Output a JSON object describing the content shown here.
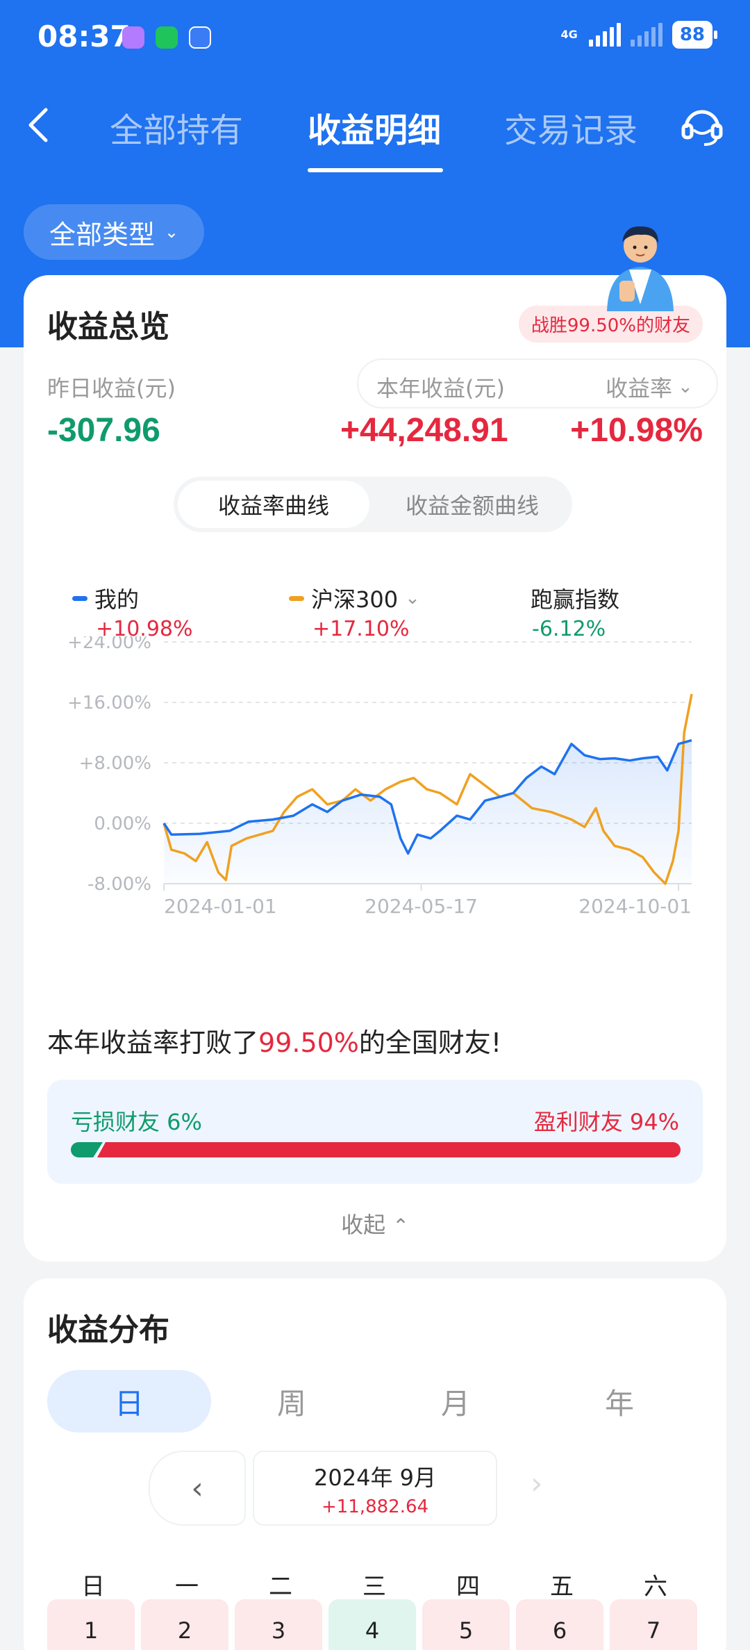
{
  "status_bar": {
    "time": "08:37",
    "network": "4G",
    "battery": "88"
  },
  "nav": {
    "tabs": [
      {
        "label": "全部持有"
      },
      {
        "label": "收益明细"
      },
      {
        "label": "交易记录"
      }
    ],
    "active_tab": 1
  },
  "filter": {
    "type_label": "全部类型"
  },
  "overview": {
    "title": "收益总览",
    "beat_badge": "战胜99.50%的财友",
    "yesterday_label": "昨日收益(元)",
    "yesterday_value": "-307.96",
    "year_label": "本年收益(元)",
    "year_value": "+44,248.91",
    "rate_label": "收益率",
    "rate_value": "+10.98%",
    "segment": {
      "active": "收益率曲线",
      "inactive": "收益金额曲线"
    },
    "legend": [
      {
        "name": "我的",
        "value": "+10.98%",
        "color": "#1f72f0"
      },
      {
        "name": "沪深300",
        "value": "+17.10%",
        "color": "#f0a020"
      },
      {
        "name": "跑赢指数",
        "value": "-6.12%"
      }
    ],
    "beat_text_prefix": "本年收益率打败了",
    "beat_text_pct": "99.50%",
    "beat_text_suffix": "的全国财友!",
    "loss_label": "亏损财友 6%",
    "profit_label": "盈利财友 94%",
    "loss_fraction": 0.06,
    "collapse_label": "收起"
  },
  "chart_data": {
    "type": "line",
    "y_ticks": [
      "+24.00%",
      "+16.00%",
      "+8.00%",
      "0.00%",
      "-8.00%"
    ],
    "ylim": [
      -8,
      24
    ],
    "x_ticks": [
      "2024-01-01",
      "2024-05-17",
      "2024-10-01"
    ],
    "x_range": [
      "2024-01-01",
      "2024-10-08"
    ],
    "series": [
      {
        "name": "我的",
        "color": "#1f72f0",
        "points": [
          [
            "2024-01-01",
            0
          ],
          [
            "2024-01-05",
            -1.5
          ],
          [
            "2024-01-20",
            -1.4
          ],
          [
            "2024-02-05",
            -1.0
          ],
          [
            "2024-02-15",
            0.2
          ],
          [
            "2024-02-28",
            0.5
          ],
          [
            "2024-03-10",
            1.0
          ],
          [
            "2024-03-20",
            2.5
          ],
          [
            "2024-03-28",
            1.5
          ],
          [
            "2024-04-05",
            3.0
          ],
          [
            "2024-04-15",
            3.8
          ],
          [
            "2024-04-25",
            3.5
          ],
          [
            "2024-05-01",
            2.5
          ],
          [
            "2024-05-06",
            -2.0
          ],
          [
            "2024-05-10",
            -4.0
          ],
          [
            "2024-05-15",
            -1.5
          ],
          [
            "2024-05-22",
            -2.0
          ],
          [
            "2024-05-27",
            -1.0
          ],
          [
            "2024-06-05",
            1.0
          ],
          [
            "2024-06-12",
            0.5
          ],
          [
            "2024-06-20",
            3.0
          ],
          [
            "2024-06-28",
            3.5
          ],
          [
            "2024-07-05",
            4.0
          ],
          [
            "2024-07-12",
            6.0
          ],
          [
            "2024-07-20",
            7.5
          ],
          [
            "2024-07-27",
            6.5
          ],
          [
            "2024-08-05",
            10.5
          ],
          [
            "2024-08-12",
            9.0
          ],
          [
            "2024-08-20",
            8.5
          ],
          [
            "2024-08-28",
            8.6
          ],
          [
            "2024-09-05",
            8.3
          ],
          [
            "2024-09-12",
            8.6
          ],
          [
            "2024-09-20",
            8.8
          ],
          [
            "2024-09-25",
            7.0
          ],
          [
            "2024-10-01",
            10.5
          ],
          [
            "2024-10-08",
            10.98
          ]
        ]
      },
      {
        "name": "沪深300",
        "color": "#f0a020",
        "points": [
          [
            "2024-01-01",
            0
          ],
          [
            "2024-01-05",
            -3.5
          ],
          [
            "2024-01-12",
            -4.0
          ],
          [
            "2024-01-18",
            -5.0
          ],
          [
            "2024-01-24",
            -2.5
          ],
          [
            "2024-01-30",
            -6.5
          ],
          [
            "2024-02-03",
            -7.5
          ],
          [
            "2024-02-06",
            -3.0
          ],
          [
            "2024-02-14",
            -2.0
          ],
          [
            "2024-02-28",
            -1.0
          ],
          [
            "2024-03-05",
            1.5
          ],
          [
            "2024-03-12",
            3.5
          ],
          [
            "2024-03-20",
            4.5
          ],
          [
            "2024-03-28",
            2.5
          ],
          [
            "2024-04-05",
            3.0
          ],
          [
            "2024-04-12",
            4.5
          ],
          [
            "2024-04-20",
            3.0
          ],
          [
            "2024-04-28",
            4.5
          ],
          [
            "2024-05-06",
            5.5
          ],
          [
            "2024-05-13",
            6.0
          ],
          [
            "2024-05-20",
            4.5
          ],
          [
            "2024-05-27",
            4.0
          ],
          [
            "2024-06-05",
            2.5
          ],
          [
            "2024-06-12",
            6.5
          ],
          [
            "2024-06-20",
            5.0
          ],
          [
            "2024-06-28",
            3.5
          ],
          [
            "2024-07-05",
            4.0
          ],
          [
            "2024-07-15",
            2.0
          ],
          [
            "2024-07-25",
            1.5
          ],
          [
            "2024-08-05",
            0.5
          ],
          [
            "2024-08-12",
            -0.5
          ],
          [
            "2024-08-18",
            2.0
          ],
          [
            "2024-08-22",
            -1.0
          ],
          [
            "2024-08-28",
            -3.0
          ],
          [
            "2024-09-05",
            -3.5
          ],
          [
            "2024-09-12",
            -4.5
          ],
          [
            "2024-09-18",
            -6.5
          ],
          [
            "2024-09-24",
            -8.0
          ],
          [
            "2024-09-28",
            -5.0
          ],
          [
            "2024-10-01",
            -1.0
          ],
          [
            "2024-10-04",
            12.0
          ],
          [
            "2024-10-08",
            17.1
          ]
        ]
      }
    ],
    "grid": true,
    "area_fill": "between series"
  },
  "distribution": {
    "title": "收益分布",
    "periods": [
      "日",
      "周",
      "月",
      "年"
    ],
    "active_period": 0,
    "month_label": "2024年 9月",
    "month_value": "+11,882.64",
    "weekdays": [
      "日",
      "一",
      "二",
      "三",
      "四",
      "五",
      "六"
    ],
    "days": [
      {
        "n": "1",
        "tone": "red"
      },
      {
        "n": "2",
        "tone": "red"
      },
      {
        "n": "3",
        "tone": "red"
      },
      {
        "n": "4",
        "tone": "green"
      },
      {
        "n": "5",
        "tone": "red"
      },
      {
        "n": "6",
        "tone": "red"
      },
      {
        "n": "7",
        "tone": "red"
      }
    ]
  }
}
